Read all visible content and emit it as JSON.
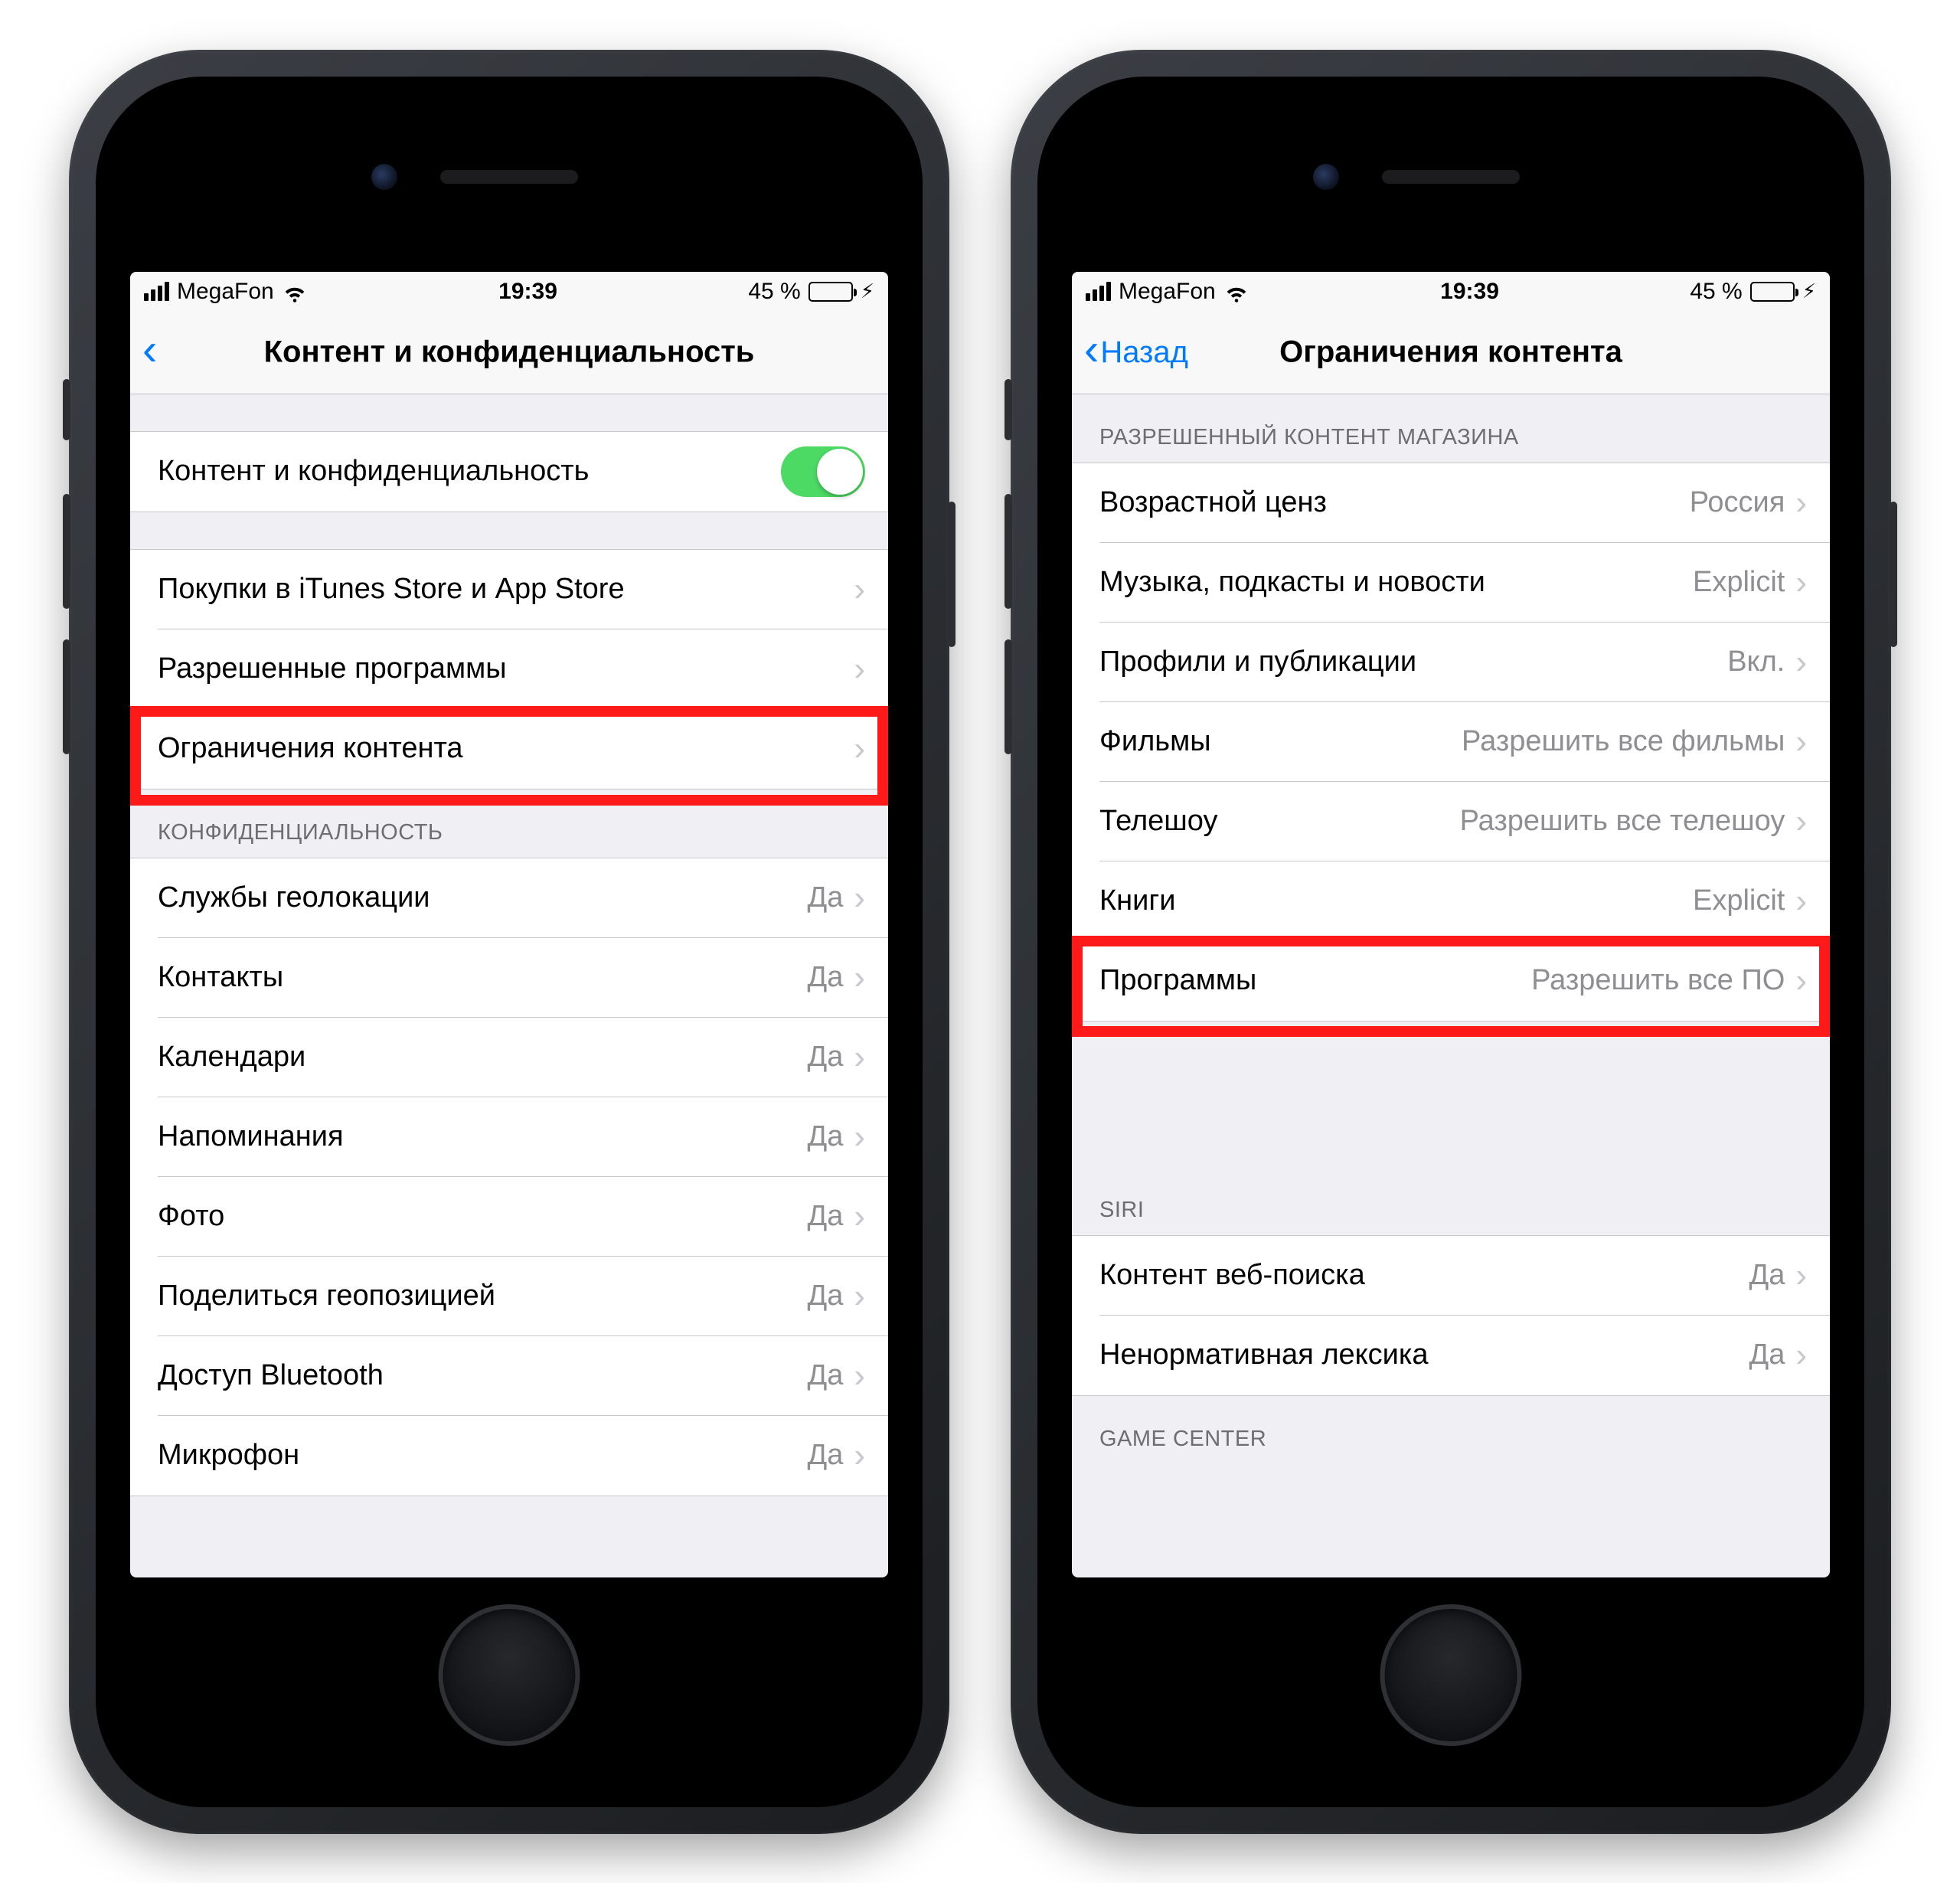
{
  "status": {
    "carrier": "MegaFon",
    "time": "19:39",
    "battery_pct": "45 %"
  },
  "left": {
    "title": "Контент и конфиденциальность",
    "toggle_label": "Контент и конфиденциальность",
    "section2": [
      "Покупки в iTunes Store и App Store",
      "Разрешенные программы",
      "Ограничения контента"
    ],
    "privacy_header": "КОНФИДЕНЦИАЛЬНОСТЬ",
    "privacy": [
      "Службы геолокации",
      "Контакты",
      "Календари",
      "Напоминания",
      "Фото",
      "Поделиться геопозицией",
      "Доступ Bluetooth",
      "Микрофон"
    ],
    "yes": "Да"
  },
  "right": {
    "back": "Назад",
    "title": "Ограничения контента",
    "store_header": "РАЗРЕШЕННЫЙ КОНТЕНТ МАГАЗИНА",
    "store": [
      {
        "label": "Возрастной ценз",
        "value": "Россия"
      },
      {
        "label": "Музыка, подкасты и новости",
        "value": "Explicit"
      },
      {
        "label": "Профили и публикации",
        "value": "Вкл."
      },
      {
        "label": "Фильмы",
        "value": "Разрешить все фильмы"
      },
      {
        "label": "Телешоу",
        "value": "Разрешить все телешоу"
      },
      {
        "label": "Книги",
        "value": "Explicit"
      },
      {
        "label": "Программы",
        "value": "Разрешить все ПО"
      }
    ],
    "siri_header": "SIRI",
    "siri": [
      {
        "label": "Контент веб-поиска",
        "value": "Да"
      },
      {
        "label": "Ненормативная лексика",
        "value": "Да"
      }
    ],
    "gc_header": "GAME CENTER"
  }
}
